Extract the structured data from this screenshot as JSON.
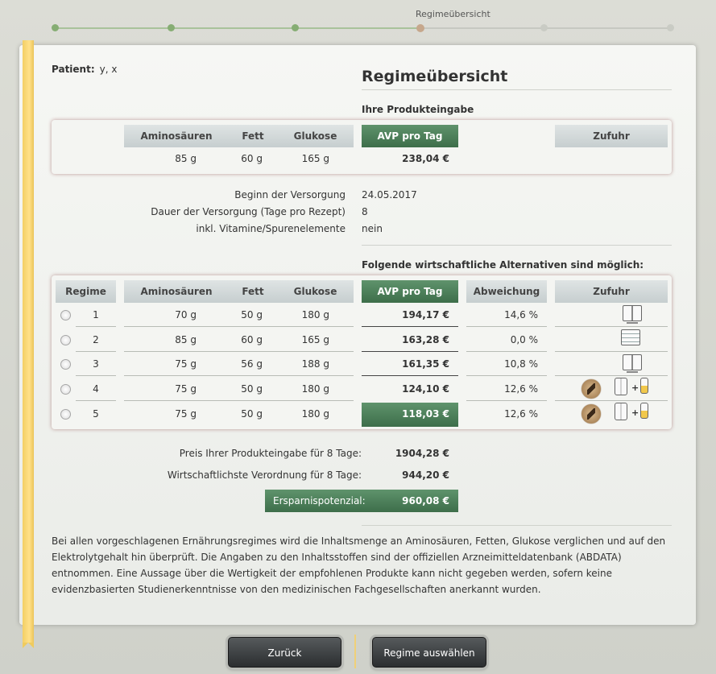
{
  "progress": {
    "current_label": "Regimeübersicht",
    "steps": [
      {
        "status": "done"
      },
      {
        "status": "done"
      },
      {
        "status": "done"
      },
      {
        "status": "current"
      },
      {
        "status": "todo"
      },
      {
        "status": "todo"
      }
    ]
  },
  "patient": {
    "label": "Patient:",
    "value": "y, x"
  },
  "title": "Regimeübersicht",
  "input_section": {
    "heading": "Ihre Produkteingabe",
    "headers": {
      "amino": "Aminosäuren",
      "fett": "Fett",
      "glukose": "Glukose",
      "avp": "AVP pro Tag",
      "zufuhr": "Zufuhr"
    },
    "row": {
      "amino": "85 g",
      "fett": "60 g",
      "glukose": "165 g",
      "avp": "238,04 €"
    }
  },
  "info": {
    "beginn_label": "Beginn der Versorgung",
    "beginn_value": "24.05.2017",
    "dauer_label": "Dauer der Versorgung (Tage pro Rezept)",
    "dauer_value": "8",
    "vitamine_label": "inkl. Vitamine/Spurenelemente",
    "vitamine_value": "nein"
  },
  "alternatives": {
    "heading": "Folgende wirtschaftliche Alternativen sind möglich:",
    "headers": {
      "regime": "Regime",
      "amino": "Aminosäuren",
      "fett": "Fett",
      "glukose": "Glukose",
      "avp": "AVP pro Tag",
      "abweichung": "Abweichung",
      "zufuhr": "Zufuhr"
    },
    "rows": [
      {
        "regime": "1",
        "amino": "70 g",
        "fett": "50 g",
        "glukose": "180 g",
        "avp": "194,17 €",
        "abweichung": "14,6 %",
        "zufuhr_icons": [
          "book-icon"
        ]
      },
      {
        "regime": "2",
        "amino": "85 g",
        "fett": "60 g",
        "glukose": "165 g",
        "avp": "163,28 €",
        "abweichung": "0,0 %",
        "zufuhr_icons": [
          "list-bag-icon"
        ]
      },
      {
        "regime": "3",
        "amino": "75 g",
        "fett": "56 g",
        "glukose": "188 g",
        "avp": "161,35 €",
        "abweichung": "10,8 %",
        "zufuhr_icons": [
          "book-icon"
        ]
      },
      {
        "regime": "4",
        "amino": "75 g",
        "fett": "50 g",
        "glukose": "180 g",
        "avp": "124,10 €",
        "abweichung": "12,6 %",
        "zufuhr_icons": [
          "medal-icon",
          "book-icon",
          "bottle-icon"
        ]
      },
      {
        "regime": "5",
        "amino": "75 g",
        "fett": "50 g",
        "glukose": "180 g",
        "avp": "118,03 €",
        "abweichung": "12,6 %",
        "zufuhr_icons": [
          "medal-icon",
          "book-icon",
          "bottle-icon"
        ],
        "highlight": true
      }
    ]
  },
  "summary": {
    "preis_label": "Preis Ihrer Produkteingabe für 8 Tage:",
    "preis_value": "1904,28 €",
    "wirtschaftlich_label": "Wirtschaftlichste Verordnung für 8 Tage:",
    "wirtschaftlich_value": "944,20 €",
    "ersparnis_label": "Ersparnispotenzial:",
    "ersparnis_value": "960,08 €"
  },
  "footnote": "Bei allen vorgeschlagenen Ernährungsregimes wird die Inhaltsmenge an Aminosäuren, Fetten, Glukose verglichen und auf den Elektrolytgehalt hin überprüft. Die Angaben zu den Inhaltsstoffen sind der offiziellen Arzneimitteldatenbank (ABDATA) entnommen. Eine Aussage über die Wertigkeit der empfohlenen Produkte kann nicht gegeben werden, sofern keine evidenzbasierten Studienerkenntnisse von den medizinischen Fachgesellschaften anerkannt wurden.",
  "buttons": {
    "back": "Zurück",
    "select": "Regime auswählen"
  },
  "colors": {
    "accent_green": "#3d6e4a",
    "bookmark": "#f3cf64",
    "done_dot": "#86ad73",
    "current_dot": "#c6a78c"
  }
}
